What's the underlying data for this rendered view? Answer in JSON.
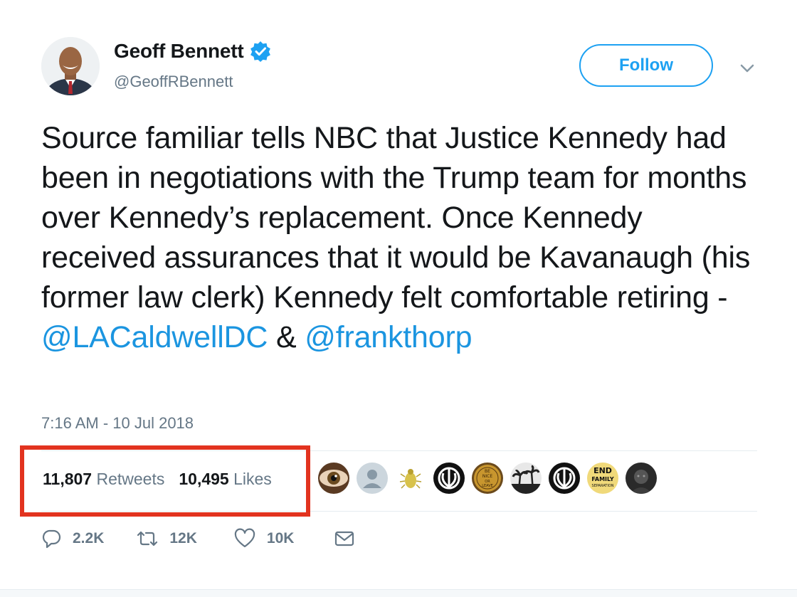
{
  "author": {
    "name": "Geoff Bennett",
    "handle": "@GeoffRBennett",
    "avatar_icon": "person-photo"
  },
  "follow_label": "Follow",
  "tweet": {
    "text_before": "Source familiar tells NBC that Justice Kennedy had been in negotiations with the Trump team for months over Kennedy’s replacement. Once Kennedy received assurances that it would be Kavanaugh (his former law clerk) Kennedy felt comfortable retiring - ",
    "mention1": "@LACaldwellDC",
    "between": " & ",
    "mention2": "@frankthorp"
  },
  "timestamp": "7:16 AM - 10 Jul 2018",
  "stats": {
    "retweets_count": "11,807",
    "retweets_label": "Retweets",
    "likes_count": "10,495",
    "likes_label": "Likes"
  },
  "liker_avatars": [
    "eye",
    "default-user",
    "beetle",
    "rebel-alliance",
    "be-nice-badge",
    "palm-trees",
    "rebel-alliance",
    "end-family-separation",
    "dark-photo"
  ],
  "liker_avatar_texts": {
    "be_nice": [
      "BE",
      "NICE",
      "OR",
      "LEAVE"
    ],
    "end_family": [
      "END",
      "FAMILY",
      "SEPARATION"
    ]
  },
  "actions": {
    "reply_count": "2.2K",
    "retweet_count": "12K",
    "like_count": "10K"
  },
  "colors": {
    "accent": "#1da1f2",
    "mention": "#1b95e0",
    "muted": "#657786",
    "highlight": "#e2331f"
  }
}
